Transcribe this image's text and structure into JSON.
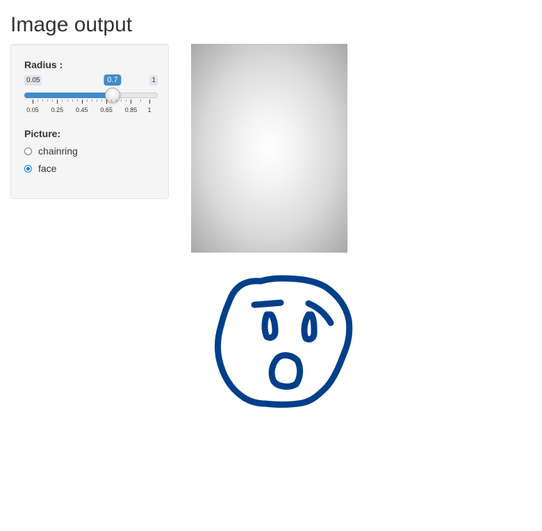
{
  "page": {
    "title": "Image output"
  },
  "controls": {
    "radius": {
      "label": "Radius :",
      "min": 0.05,
      "max": 1,
      "value": 0.7,
      "min_label": "0.05",
      "max_label": "1",
      "value_label": "0.7",
      "ticks": [
        "0.05",
        "0.25",
        "0.45",
        "0.65",
        "0.85",
        "1"
      ]
    },
    "picture": {
      "label": "Picture:",
      "options": [
        {
          "label": "chainring",
          "checked": false
        },
        {
          "label": "face",
          "checked": true
        }
      ]
    }
  },
  "colors": {
    "accent": "#428bca",
    "face_stroke": "#003f8a"
  },
  "images": {
    "radial_gradient": "radial-gradient-image",
    "face_drawing": "face-drawing"
  }
}
